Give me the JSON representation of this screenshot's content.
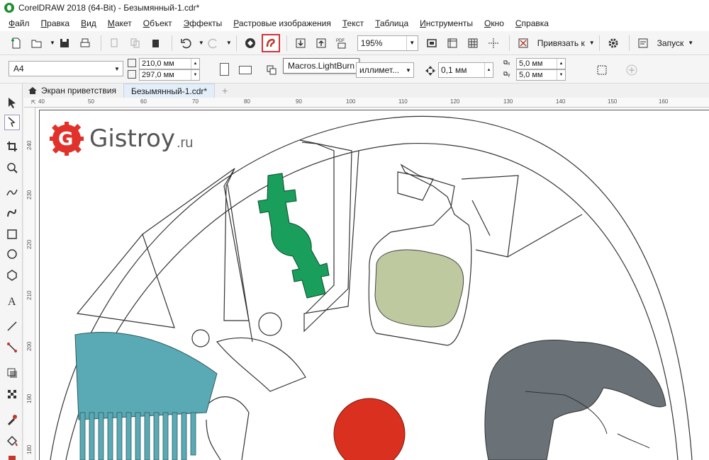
{
  "window": {
    "title": "CorelDRAW 2018 (64-Bit) - Безымянный-1.cdr*"
  },
  "menu": [
    "Файл",
    "Правка",
    "Вид",
    "Макет",
    "Объект",
    "Эффекты",
    "Растровые изображения",
    "Текст",
    "Таблица",
    "Инструменты",
    "Окно",
    "Справка"
  ],
  "toolbar": {
    "zoom": "195%",
    "snap_label": "Привязать к",
    "launch_label": "Запуск"
  },
  "propbar": {
    "page_size": "A4",
    "width": "210,0 мм",
    "height": "297,0 мм",
    "units": "иллимет...",
    "nudge": "0,1 мм",
    "dup_x": "5,0 мм",
    "dup_y": "5,0 мм"
  },
  "tooltip": "Macros.LightBurn",
  "tabs": [
    "Экран приветствия",
    "Безымянный-1.cdr*"
  ],
  "ruler_h": [
    "40",
    "50",
    "60",
    "70",
    "80",
    "90",
    "100",
    "110",
    "120",
    "130",
    "140",
    "150",
    "160"
  ],
  "ruler_v": [
    "240",
    "230",
    "220",
    "210",
    "200",
    "190",
    "180"
  ],
  "logo": {
    "name": "Gistroy",
    "tld": ".ru"
  },
  "colors": {
    "highlight": "#d0333a",
    "razor": "#1a9e5c",
    "bottle": "#bfc9a0",
    "comb": "#5aaab5",
    "hair": "#6a7277",
    "dot": "#d9301f",
    "logo": "#e0312a"
  }
}
